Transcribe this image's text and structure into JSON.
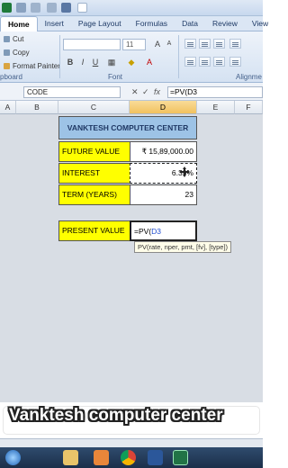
{
  "tabs": [
    {
      "label": "Home",
      "active": true
    },
    {
      "label": "Insert",
      "active": false
    },
    {
      "label": "Page Layout",
      "active": false
    },
    {
      "label": "Formulas",
      "active": false
    },
    {
      "label": "Data",
      "active": false
    },
    {
      "label": "Review",
      "active": false
    },
    {
      "label": "View",
      "active": false
    }
  ],
  "ribbon": {
    "clipboard": {
      "cut": "Cut",
      "copy": "Copy",
      "format_painter": "Format Painter",
      "label": "pboard"
    },
    "font": {
      "size": "11",
      "bold": "B",
      "italic": "I",
      "underline": "U",
      "label": "Font"
    },
    "alignment_label": "Alignme"
  },
  "formula_bar": {
    "name_box": "CODE",
    "cancel": "✕",
    "enter": "✓",
    "fx": "fx",
    "formula": "=PV(D3"
  },
  "columns": [
    "A",
    "B",
    "C",
    "D",
    "E",
    "F"
  ],
  "sheet": {
    "title": "VANKTESH COMPUTER CENTER",
    "rows": [
      {
        "label": "FUTURE VALUE",
        "value": "₹ 15,89,000.00"
      },
      {
        "label": "INTEREST",
        "value": "6.39%"
      },
      {
        "label": "TERM (YEARS)",
        "value": "23"
      }
    ],
    "present_value_label": "PRESENT VALUE",
    "present_value_prefix": "=PV(",
    "present_value_ref": "D3"
  },
  "tooltip": "PV(rate, nper, pmt, [fv], [type])",
  "banner": "Vanktesh computer center",
  "colors": {
    "title_bg": "#9dc3e6",
    "yellow": "#ffff00",
    "taskbar": "#1b2f4a"
  },
  "taskbar_icons": [
    "start-orb-icon",
    "folder-icon",
    "media-player-icon",
    "chrome-icon",
    "word-icon",
    "excel-icon"
  ]
}
